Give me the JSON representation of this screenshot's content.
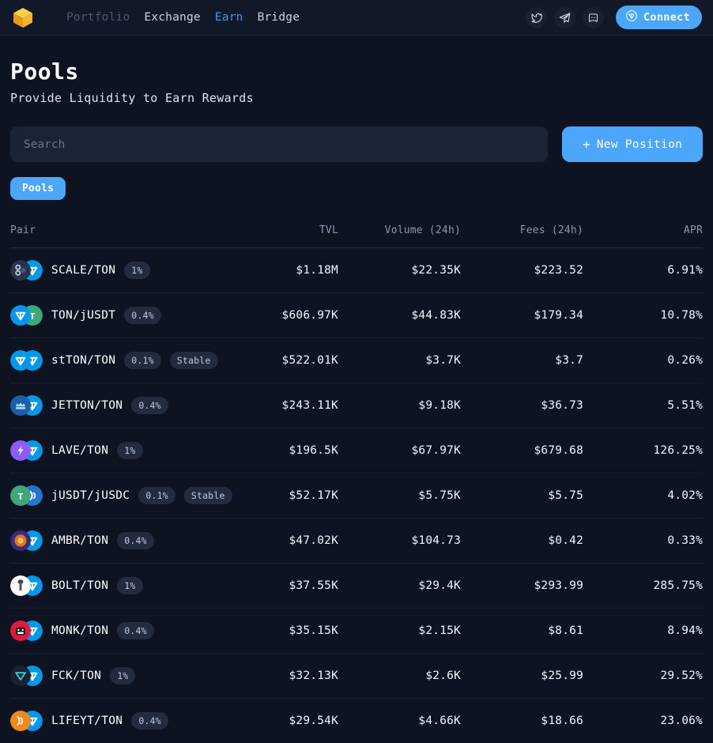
{
  "navbar": {
    "logo_icon": "cube-logo-icon",
    "links": [
      {
        "label": "Portfolio",
        "state": "muted"
      },
      {
        "label": "Exchange",
        "state": "normal"
      },
      {
        "label": "Earn",
        "state": "active"
      },
      {
        "label": "Bridge",
        "state": "normal"
      }
    ],
    "socials": [
      {
        "name": "twitter-icon"
      },
      {
        "name": "telegram-icon"
      },
      {
        "name": "discord-icon"
      }
    ],
    "connect": {
      "label": "Connect",
      "icon": "ton-diamond-icon",
      "color": "#4ca6fb"
    }
  },
  "header": {
    "title": "Pools",
    "subtitle": "Provide Liquidity to Earn Rewards"
  },
  "search": {
    "placeholder": "Search",
    "value": ""
  },
  "new_position": {
    "label": "New Position",
    "plus": "+"
  },
  "tabs": [
    {
      "label": "Pools",
      "active": true
    }
  ],
  "table": {
    "columns": [
      {
        "key": "pair",
        "label": "Pair"
      },
      {
        "key": "tvl",
        "label": "TVL"
      },
      {
        "key": "vol",
        "label": "Volume (24h)"
      },
      {
        "key": "fees",
        "label": "Fees (24h)"
      },
      {
        "key": "apr",
        "label": "APR"
      }
    ],
    "rows": [
      {
        "pair": "SCALE/TON",
        "fee": "1%",
        "stable": null,
        "tvl": "$1.18M",
        "vol": "$22.35K",
        "fees": "$223.52",
        "apr": "6.91%",
        "icon_a": "scale-token-icon",
        "icon_b": "ton-token-icon"
      },
      {
        "pair": "TON/jUSDT",
        "fee": "0.4%",
        "stable": null,
        "tvl": "$606.97K",
        "vol": "$44.83K",
        "fees": "$179.34",
        "apr": "10.78%",
        "icon_a": "ton-token-icon",
        "icon_b": "jusdt-token-icon"
      },
      {
        "pair": "stTON/TON",
        "fee": "0.1%",
        "stable": "Stable",
        "tvl": "$522.01K",
        "vol": "$3.7K",
        "fees": "$3.7",
        "apr": "0.26%",
        "icon_a": "stton-token-icon",
        "icon_b": "ton-token-icon"
      },
      {
        "pair": "JETTON/TON",
        "fee": "0.4%",
        "stable": null,
        "tvl": "$243.11K",
        "vol": "$9.18K",
        "fees": "$36.73",
        "apr": "5.51%",
        "icon_a": "jetton-token-icon",
        "icon_b": "ton-token-icon"
      },
      {
        "pair": "LAVE/TON",
        "fee": "1%",
        "stable": null,
        "tvl": "$196.5K",
        "vol": "$67.97K",
        "fees": "$679.68",
        "apr": "126.25%",
        "icon_a": "lave-token-icon",
        "icon_b": "ton-token-icon"
      },
      {
        "pair": "jUSDT/jUSDC",
        "fee": "0.1%",
        "stable": "Stable",
        "tvl": "$52.17K",
        "vol": "$5.75K",
        "fees": "$5.75",
        "apr": "4.02%",
        "icon_a": "jusdt-token-icon",
        "icon_b": "jusdc-token-icon"
      },
      {
        "pair": "AMBR/TON",
        "fee": "0.4%",
        "stable": null,
        "tvl": "$47.02K",
        "vol": "$104.73",
        "fees": "$0.42",
        "apr": "0.33%",
        "icon_a": "ambr-token-icon",
        "icon_b": "ton-token-icon"
      },
      {
        "pair": "BOLT/TON",
        "fee": "1%",
        "stable": null,
        "tvl": "$37.55K",
        "vol": "$29.4K",
        "fees": "$293.99",
        "apr": "285.75%",
        "icon_a": "bolt-token-icon",
        "icon_b": "ton-token-icon"
      },
      {
        "pair": "MONK/TON",
        "fee": "0.4%",
        "stable": null,
        "tvl": "$35.15K",
        "vol": "$2.15K",
        "fees": "$8.61",
        "apr": "8.94%",
        "icon_a": "monk-token-icon",
        "icon_b": "ton-token-icon"
      },
      {
        "pair": "FCK/TON",
        "fee": "1%",
        "stable": null,
        "tvl": "$32.13K",
        "vol": "$2.6K",
        "fees": "$25.99",
        "apr": "29.52%",
        "icon_a": "fck-token-icon",
        "icon_b": "ton-token-icon"
      },
      {
        "pair": "LIFEYT/TON",
        "fee": "0.4%",
        "stable": null,
        "tvl": "$29.54K",
        "vol": "$4.66K",
        "fees": "$18.66",
        "apr": "23.06%",
        "icon_a": "lifeyt-token-icon",
        "icon_b": "ton-token-icon"
      }
    ]
  },
  "colors": {
    "background": "#0d1321",
    "navbar": "#111827",
    "accent": "#4ca6fb",
    "active_link": "#3b9bf5",
    "muted_text": "#8b96ad",
    "badge_bg": "#232c3e"
  }
}
